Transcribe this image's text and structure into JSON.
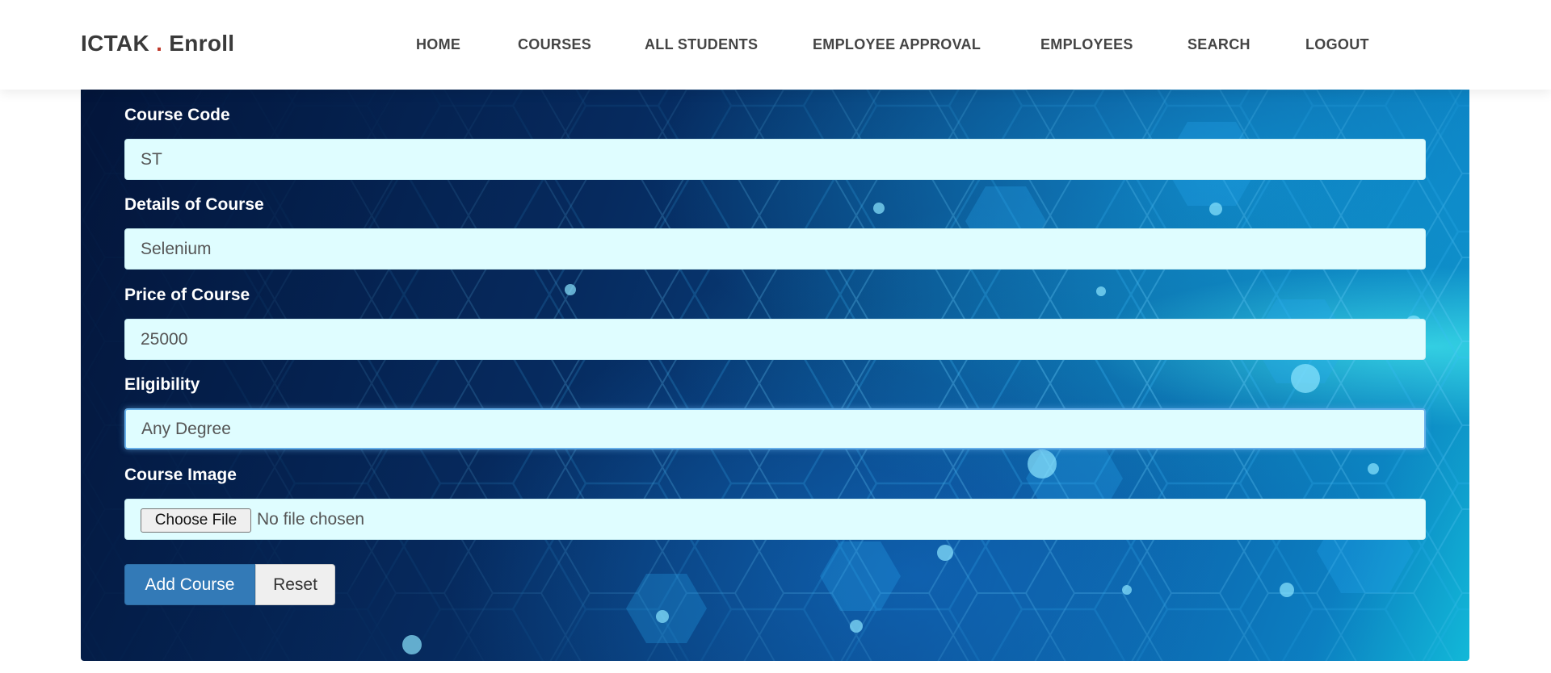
{
  "brand": {
    "name": "ICTAK",
    "dot": ".",
    "suffix": "Enroll"
  },
  "nav": {
    "items": [
      {
        "label": "HOME"
      },
      {
        "label": "COURSES"
      },
      {
        "label": "ALL STUDENTS"
      },
      {
        "label": "EMPLOYEE APPROVAL"
      },
      {
        "label": "EMPLOYEES"
      },
      {
        "label": "SEARCH"
      },
      {
        "label": "LOGOUT"
      }
    ]
  },
  "form": {
    "course_code": {
      "label": "Course Code",
      "value": "ST"
    },
    "details": {
      "label": "Details of Course",
      "value": "Selenium"
    },
    "price": {
      "label": "Price of Course",
      "value": "25000"
    },
    "eligibility": {
      "label": "Eligibility",
      "value": "Any Degree"
    },
    "image": {
      "label": "Course Image",
      "button_label": "Choose File",
      "status": "No file chosen"
    },
    "submit_label": "Add Course",
    "reset_label": "Reset"
  },
  "colors": {
    "brand_dot": "#c0392b",
    "primary_button": "#337ab7",
    "input_background": "#dffdff"
  }
}
